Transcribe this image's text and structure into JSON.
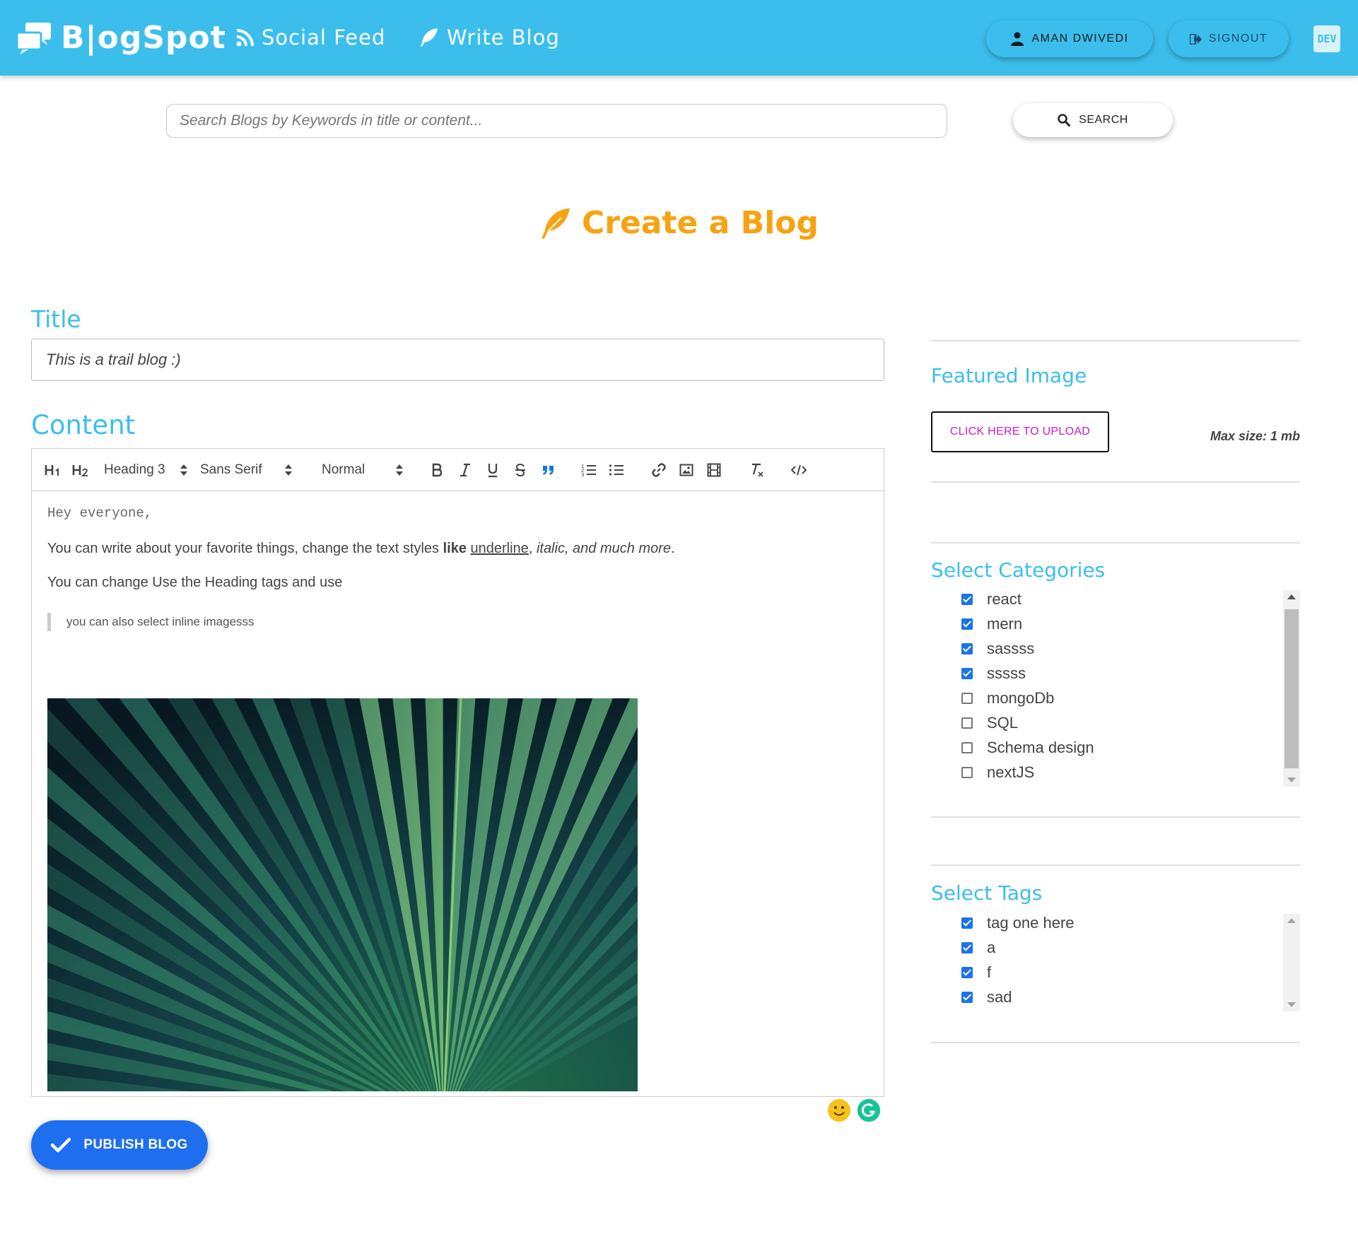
{
  "brand": {
    "name": "B|ogSpot"
  },
  "nav": {
    "social_feed": "Social Feed",
    "write_blog": "Write Blog"
  },
  "user": {
    "name": "AMAN DWIVEDI",
    "signout": "SIGNOUT",
    "dev_badge": "DEV"
  },
  "search": {
    "placeholder": "Search Blogs by Keywords in title or content...",
    "button": "SEARCH"
  },
  "page": {
    "title": "Create a Blog"
  },
  "form": {
    "title_label": "Title",
    "title_value": "This is a trail blog :)",
    "content_label": "Content"
  },
  "editor": {
    "toolbar": {
      "h1": "H1",
      "h2": "H2",
      "header_select": "Heading 3",
      "font_select": "Sans Serif",
      "size_select": "Normal"
    },
    "content": {
      "line1": "Hey everyone,",
      "p1_a": "You can write about your favorite things, change the text styles ",
      "p1_bold": "like",
      "p1_space": " ",
      "p1_underline": "underline",
      "p1_comma": ", ",
      "p1_italic": "italic, and much more",
      "p1_end": ".",
      "p2": "You can change Use the Heading tags and  use",
      "quote": "you can also select inline imagesss"
    }
  },
  "publish": {
    "label": "PUBLISH BLOG"
  },
  "sidebar": {
    "featured_image": {
      "label": "Featured Image",
      "upload_button": "CLICK HERE TO UPLOAD",
      "max_size": "Max size: 1 mb"
    },
    "categories": {
      "label": "Select Categories",
      "items": [
        {
          "label": "react",
          "checked": true
        },
        {
          "label": "mern",
          "checked": true
        },
        {
          "label": "sassss",
          "checked": true
        },
        {
          "label": "sssss",
          "checked": true
        },
        {
          "label": "mongoDb",
          "checked": false
        },
        {
          "label": "SQL",
          "checked": false
        },
        {
          "label": "Schema design",
          "checked": false
        },
        {
          "label": "nextJS",
          "checked": false
        }
      ]
    },
    "tags": {
      "label": "Select Tags",
      "items": [
        {
          "label": "tag one here",
          "checked": true
        },
        {
          "label": "a",
          "checked": true
        },
        {
          "label": "f",
          "checked": true
        },
        {
          "label": "sad",
          "checked": true
        }
      ]
    }
  },
  "colors": {
    "header": "#3bbeec",
    "accent_label": "#3bbeec",
    "title_orange": "#f6a313",
    "publish_blue": "#1e6ef0",
    "upload_text": "#c21fc9",
    "checkbox_blue": "#1a73e8"
  },
  "icons": {
    "brand": "chat-bubbles-icon",
    "social_feed": "rss-icon",
    "write_blog": "feather-icon",
    "user": "user-icon",
    "signout": "signout-icon",
    "search": "search-icon",
    "page_title": "feather-icon",
    "publish": "check-icon"
  }
}
